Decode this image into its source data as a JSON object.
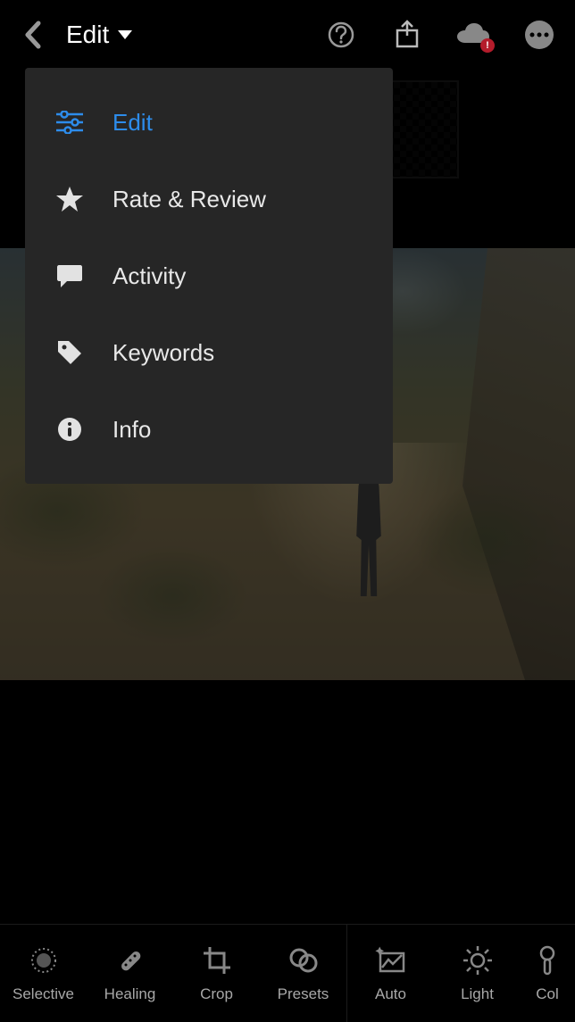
{
  "header": {
    "mode_label": "Edit"
  },
  "menu": {
    "items": [
      {
        "label": "Edit",
        "icon": "sliders-icon",
        "active": true
      },
      {
        "label": "Rate & Review",
        "icon": "star-icon",
        "active": false
      },
      {
        "label": "Activity",
        "icon": "chat-icon",
        "active": false
      },
      {
        "label": "Keywords",
        "icon": "tag-icon",
        "active": false
      },
      {
        "label": "Info",
        "icon": "info-icon",
        "active": false
      }
    ]
  },
  "toolbar": {
    "left": [
      {
        "label": "Selective",
        "icon": "selective-icon"
      },
      {
        "label": "Healing",
        "icon": "healing-icon"
      },
      {
        "label": "Crop",
        "icon": "crop-icon"
      },
      {
        "label": "Presets",
        "icon": "presets-icon"
      }
    ],
    "right": [
      {
        "label": "Auto",
        "icon": "auto-icon"
      },
      {
        "label": "Light",
        "icon": "light-icon"
      },
      {
        "label": "Col",
        "icon": "color-icon"
      }
    ]
  }
}
